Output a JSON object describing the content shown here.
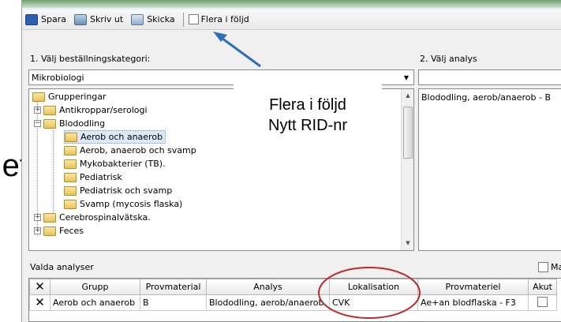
{
  "slide_text": "et",
  "toolbar": {
    "save_label": "Spara",
    "print_label": "Skriv ut",
    "send_label": "Skicka",
    "flera_label": "Flera i följd"
  },
  "category": {
    "label": "1. Välj beställningskategori:",
    "selected": "Mikrobiologi"
  },
  "analysis": {
    "label": "2. Välj analys",
    "items": [
      "Blododling, aerob/anaerob - B"
    ]
  },
  "tree": [
    {
      "label": "Grupperingar"
    },
    {
      "label": "Antikroppar/serologi"
    },
    {
      "label": "Blododling"
    },
    {
      "label": "Aerob och anaerob"
    },
    {
      "label": "Aerob, anaerob och svamp"
    },
    {
      "label": "Mykobakterier (TB)."
    },
    {
      "label": "Pediatrisk"
    },
    {
      "label": "Pediatrisk och svamp"
    },
    {
      "label": "Svamp (mycosis flaska)"
    },
    {
      "label": "Cerebrospinalvätska."
    },
    {
      "label": "Feces"
    }
  ],
  "callout": {
    "line1": "Flera i följd",
    "line2": "Nytt RID-nr"
  },
  "selected_analyses": {
    "label": "Valda analyser",
    "right_checkbox_label": "Ma",
    "columns": [
      "Grupp",
      "Provmaterial",
      "Analys",
      "Lokalisation",
      "Provmateriel",
      "Akut"
    ],
    "rows": [
      {
        "grupp": "Aerob och anaerob",
        "provmaterial": "B",
        "analys": "Blododling, aerob/anaerob",
        "lokalisation": "CVK",
        "provmateriel": "Ae+an blodflaska - F3"
      }
    ]
  },
  "colors": {
    "arrow": "#2f6fb8",
    "ellipse": "#c0282d",
    "tree_selection": "#dde9f8"
  }
}
